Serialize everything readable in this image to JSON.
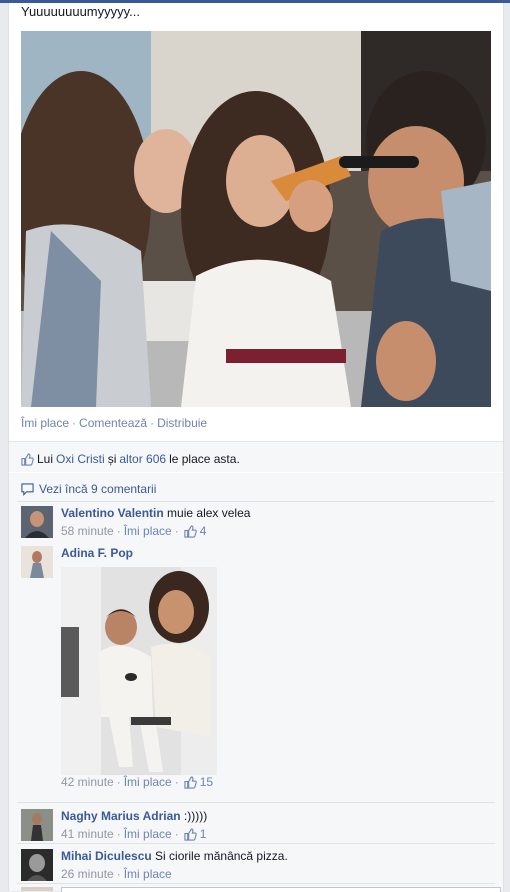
{
  "post": {
    "text": "Yuuuuuuuumyyyyy...",
    "actions": {
      "like": "Îmi place",
      "comment": "Comentează",
      "share": "Distribuie",
      "separator": "·"
    },
    "likes": {
      "prefix": "Lui",
      "friend": "Oxi Cristi",
      "and": "și",
      "others": "altor 606",
      "suffix": "le place asta."
    }
  },
  "comments": {
    "view_more": "Vezi încă 9 comentarii",
    "like_label": "Îmi place",
    "items": [
      {
        "author": "Valentino Valentin",
        "text": "muie alex velea",
        "time": "58 minute",
        "likes": "4"
      },
      {
        "author": "Adina F. Pop",
        "text": "",
        "time": "42 minute",
        "likes": "15"
      },
      {
        "author": "Naghy Marius Adrian",
        "text": ":)))))",
        "time": "41 minute",
        "likes": "1"
      },
      {
        "author": "Mihai Diculescu",
        "text": "Si ciorile mănâncă pizza.",
        "time": "26 minute",
        "likes": ""
      }
    ]
  },
  "colors": {
    "brand": "#3b5998",
    "link": "#6d84b4",
    "meta": "#9197a3",
    "background": "#e9eaed"
  },
  "icons": {
    "like": "thumbs-up-icon",
    "comment": "speech-bubble-icon"
  }
}
